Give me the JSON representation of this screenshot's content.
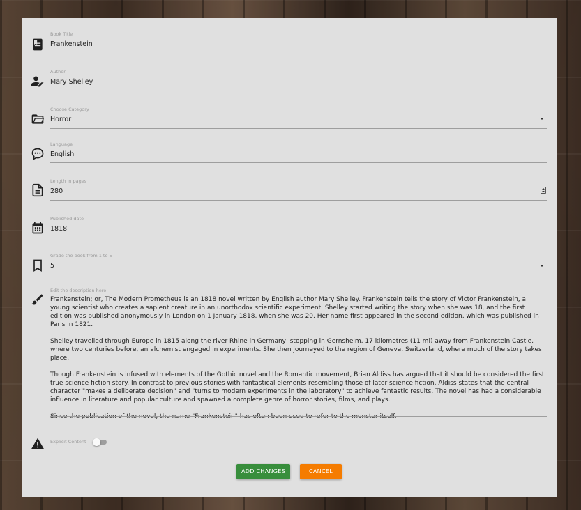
{
  "colors": {
    "card_bg": "#e0e0e0",
    "save_button": "#388e3c",
    "cancel_button": "#f57c00",
    "icon": "#212121"
  },
  "form": {
    "title": {
      "label": "Book Title",
      "value": "Frankenstein",
      "icon": "book-icon"
    },
    "author": {
      "label": "Author",
      "value": "Mary Shelley",
      "icon": "account-edit-icon"
    },
    "category": {
      "label": "Choose Category",
      "value": "Horror",
      "icon": "folder-open-icon"
    },
    "language": {
      "label": "Language",
      "value": "English",
      "icon": "chat-bubble-icon"
    },
    "length": {
      "label": "Length in pages",
      "value": "280",
      "icon": "document-icon"
    },
    "published": {
      "label": "Published date",
      "value": "1818",
      "icon": "calendar-icon"
    },
    "grade": {
      "label": "Grade the book from 1 to 5",
      "value": "5",
      "icon": "bookmark-icon"
    },
    "description": {
      "label": "Edit the description here",
      "icon": "brush-icon",
      "paragraphs": [
        "Frankenstein; or, The Modern Prometheus is an 1818 novel written by English author Mary Shelley. Frankenstein tells the story of Victor Frankenstein, a young scientist who creates a sapient creature in an unorthodox scientific experiment. Shelley started writing the story when she was 18, and the first edition was published anonymously in London on 1 January 1818, when she was 20. Her name first appeared in the second edition, which was published in Paris in 1821.",
        "Shelley travelled through Europe in 1815 along the river Rhine in Germany, stopping in Gernsheim, 17 kilometres (11 mi) away from Frankenstein Castle, where two centuries before, an alchemist engaged in experiments. She then journeyed to the region of Geneva, Switzerland, where much of the story takes place.",
        "Though Frankenstein is infused with elements of the Gothic novel and the Romantic movement, Brian Aldiss has argued that it should be considered the first true science fiction story. In contrast to previous stories with fantastical elements resembling those of later science fiction, Aldiss states that the central character \"makes a deliberate decision\" and \"turns to modern experiments in the laboratory\" to achieve fantastic results. The novel has had a considerable influence in literature and popular culture and spawned a complete genre of horror stories, films, and plays.",
        "Since the publication of the novel, the name \"Frankenstein\" has often been used to refer to the monster itself."
      ]
    },
    "explicit": {
      "label": "Explicit Content",
      "checked": false,
      "icon": "warning-icon"
    }
  },
  "actions": {
    "save_label": "ADD CHANGES",
    "cancel_label": "CANCEL"
  }
}
